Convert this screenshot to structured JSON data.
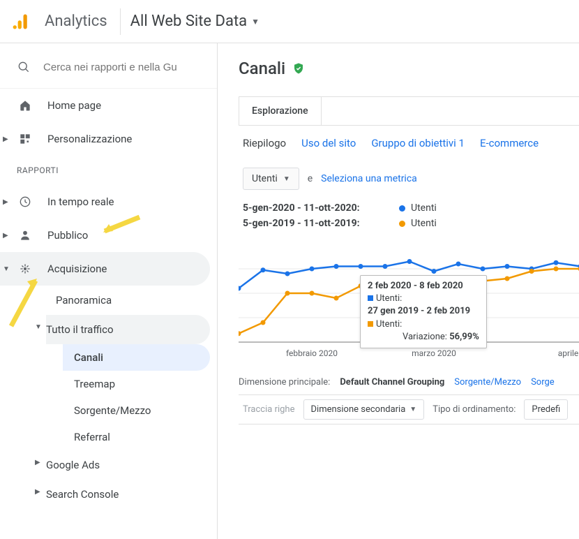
{
  "brand": "Analytics",
  "view_selector": "All Web Site Data",
  "search": {
    "placeholder": "Cerca nei rapporti e nella Gu"
  },
  "nav": {
    "home": "Home page",
    "customization": "Personalizzazione",
    "reports_label": "RAPPORTI",
    "realtime": "In tempo reale",
    "audience": "Pubblico",
    "acquisition": {
      "label": "Acquisizione",
      "overview": "Panoramica",
      "all_traffic": {
        "label": "Tutto il traffico",
        "channels": "Canali",
        "treemap": "Treemap",
        "source_medium": "Sorgente/Mezzo",
        "referral": "Referral"
      },
      "google_ads": "Google Ads",
      "search_console": "Search Console"
    }
  },
  "title": "Canali",
  "tabs": {
    "exploration": "Esplorazione"
  },
  "subtabs": {
    "summary": "Riepilogo",
    "site_usage": "Uso del sito",
    "goal_group": "Gruppo di obiettivi 1",
    "ecommerce": "E-commerce"
  },
  "metric": {
    "selector": "Utenti",
    "vs": "e",
    "select_metric": "Seleziona una metrica"
  },
  "legend": {
    "range1": "5-gen-2020 - 11-ott-2020:",
    "range2": "5-gen-2019 - 11-ott-2019:",
    "series_label": "Utenti"
  },
  "tooltip": {
    "bucket1": "2 feb 2020 - 8 feb 2020",
    "label1": "Utenti:",
    "bucket2": "27 gen 2019 - 2 feb 2019",
    "label2": "Utenti:",
    "variation_label": "Variazione:",
    "variation_value": "56,99%"
  },
  "dim_row": {
    "label": "Dimensione principale:",
    "value": "Default Channel Grouping",
    "source_medium": "Sorgente/Mezzo",
    "source": "Sorge"
  },
  "ctrl_row": {
    "trace": "Traccia righe",
    "secondary": "Dimensione secondaria",
    "sort_label": "Tipo di ordinamento:",
    "sort_value": "Predefi"
  },
  "colors": {
    "blue": "#1a73e8",
    "orange": "#f29900"
  },
  "chart_data": {
    "type": "line",
    "x_labels": [
      "febbraio 2020",
      "marzo 2020",
      "aprile"
    ],
    "series": [
      {
        "name": "Utenti 2020",
        "color": "#1a73e8",
        "x": [
          0,
          1,
          2,
          3,
          4,
          5,
          6,
          7,
          8,
          9,
          10,
          11,
          12,
          13,
          14
        ],
        "y": [
          44,
          59,
          56,
          60,
          62,
          62,
          62,
          66,
          58,
          64,
          60,
          62,
          60,
          65,
          62
        ]
      },
      {
        "name": "Utenti 2019",
        "color": "#f29900",
        "x": [
          0,
          1,
          2,
          3,
          4,
          5,
          6,
          7,
          8,
          9,
          10,
          11,
          12,
          13,
          14
        ],
        "y": [
          7,
          16,
          40,
          40,
          36,
          46,
          46,
          49,
          48,
          46,
          50,
          52,
          58,
          60,
          60
        ]
      }
    ],
    "ylim": [
      0,
      80
    ],
    "gridlines": [
      20,
      40,
      60
    ]
  }
}
